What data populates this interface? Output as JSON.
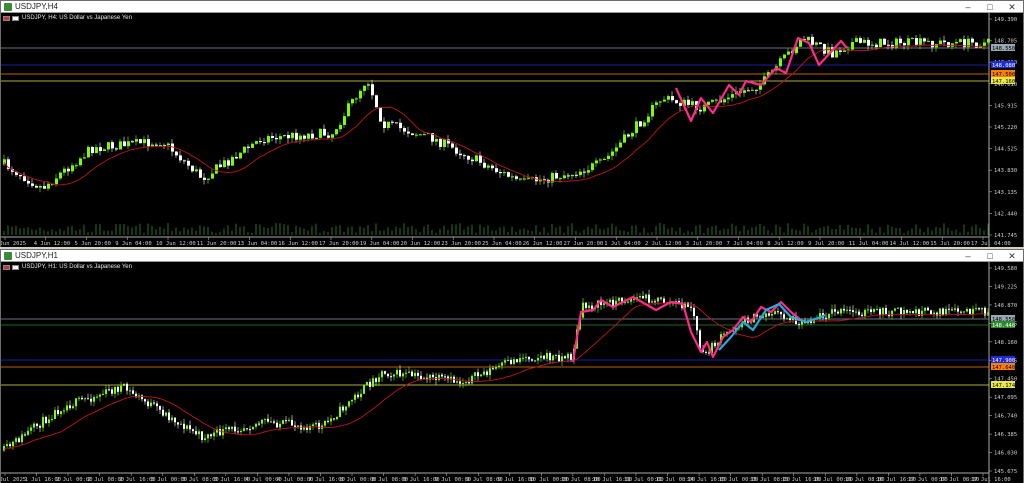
{
  "windows": [
    {
      "title": "USDJPY,H4",
      "legend": "USDJPY, H4:  US Dollar vs Japanese Yen",
      "price_axis": [
        "149.390",
        "148.705",
        "147.390",
        "146.610",
        "145.915",
        "145.220",
        "144.525",
        "143.830",
        "143.135",
        "142.440",
        "141.745"
      ],
      "price_tags": [
        {
          "text": "148.550",
          "bg": "#9aa6b2",
          "fg": "#000000"
        },
        {
          "text": "148.080",
          "bg": "#1c2bd4",
          "fg": "#ffffff"
        },
        {
          "text": "147.500",
          "bg": "#ff8000",
          "fg": "#000000"
        },
        {
          "text": "147.160",
          "bg": "#e8e84a",
          "fg": "#000000"
        }
      ],
      "time_axis": [
        "3 Jun 2025",
        "4 Jun 12:00",
        "5 Jun 20:00",
        "9 Jun 04:00",
        "10 Jun 12:00",
        "11 Jun 20:00",
        "13 Jun 04:00",
        "16 Jun 12:00",
        "17 Jun 20:00",
        "19 Jun 04:00",
        "20 Jun 12:00",
        "23 Jun 20:00",
        "25 Jun 04:00",
        "26 Jun 12:00",
        "27 Jun 20:00",
        "1 Jul 04:00",
        "2 Jul 12:00",
        "3 Jul 20:00",
        "7 Jul 04:00",
        "8 Jul 12:00",
        "9 Jul 20:00",
        "11 Jul 04:00",
        "14 Jul 12:00",
        "15 Jul 20:00",
        "17 Jul 04:00"
      ]
    },
    {
      "title": "USDJPY,H1",
      "legend": "USDJPY, H1:  US Dollar vs Japanese Yen",
      "price_axis": [
        "149.580",
        "149.225",
        "148.870",
        "148.515",
        "148.160",
        "147.805",
        "147.450",
        "147.095",
        "146.740",
        "146.385",
        "146.030",
        "145.675"
      ],
      "price_tags": [
        {
          "text": "148.550",
          "bg": "#9aa6b2",
          "fg": "#000000"
        },
        {
          "text": "148.440",
          "bg": "#2c8a2c",
          "fg": "#ffffff"
        },
        {
          "text": "147.900",
          "bg": "#1c2bd4",
          "fg": "#ffffff"
        },
        {
          "text": "147.640",
          "bg": "#ff8000",
          "fg": "#000000"
        },
        {
          "text": "147.174",
          "bg": "#e8e84a",
          "fg": "#000000"
        }
      ],
      "time_axis": [
        "1 Jul 2025",
        "1 Jul 16:00",
        "2 Jul 00:00",
        "2 Jul 08:00",
        "2 Jul 16:00",
        "3 Jul 00:00",
        "3 Jul 08:00",
        "3 Jul 16:00",
        "4 Jul 00:00",
        "4 Jul 08:00",
        "7 Jul 16:00",
        "8 Jul 00:00",
        "8 Jul 08:00",
        "8 Jul 16:00",
        "9 Jul 00:00",
        "9 Jul 08:00",
        "9 Jul 16:00",
        "10 Jul 00:00",
        "10 Jul 08:00",
        "10 Jul 16:00",
        "11 Jul 00:00",
        "11 Jul 08:00",
        "14 Jul 16:00",
        "15 Jul 00:00",
        "15 Jul 08:00",
        "15 Jul 16:00",
        "16 Jul 00:00",
        "16 Jul 08:00",
        "16 Jul 16:00",
        "17 Jul 00:00",
        "17 Jul 08:00",
        "17 Jul 16:00"
      ]
    }
  ],
  "colors": {
    "bull": "#7cfc00",
    "bear": "#ffffff",
    "ma": "#c0141e",
    "zigzag": "#ff2a8a",
    "zigzag2": "#29a8e0",
    "grid_line": "#6e6e6e"
  },
  "icons": [
    "chart-window-icon",
    "minimize-icon",
    "maximize-icon",
    "close-icon"
  ]
}
